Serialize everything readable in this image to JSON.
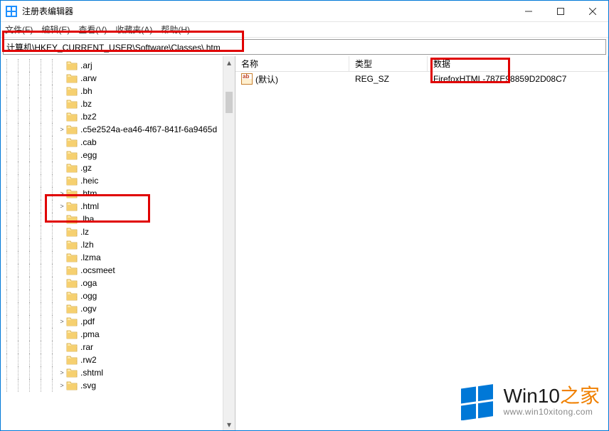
{
  "titlebar": {
    "title": "注册表编辑器"
  },
  "menubar": {
    "file": "文件(F)",
    "edit": "编辑(E)",
    "view": "查看(V)",
    "favorites": "收藏夹(A)",
    "help": "帮助(H)"
  },
  "addressbar": {
    "path": "计算机\\HKEY_CURRENT_USER\\Software\\Classes\\.htm"
  },
  "tree": {
    "items": [
      {
        "label": ".arj",
        "depth": 5,
        "caret": ""
      },
      {
        "label": ".arw",
        "depth": 5,
        "caret": ""
      },
      {
        "label": ".bh",
        "depth": 5,
        "caret": ""
      },
      {
        "label": ".bz",
        "depth": 5,
        "caret": ""
      },
      {
        "label": ".bz2",
        "depth": 5,
        "caret": ""
      },
      {
        "label": ".c5e2524a-ea46-4f67-841f-6a9465d",
        "depth": 5,
        "caret": ">"
      },
      {
        "label": ".cab",
        "depth": 5,
        "caret": ""
      },
      {
        "label": ".egg",
        "depth": 5,
        "caret": ""
      },
      {
        "label": ".gz",
        "depth": 5,
        "caret": ""
      },
      {
        "label": ".heic",
        "depth": 5,
        "caret": ""
      },
      {
        "label": ".htm",
        "depth": 5,
        "caret": ">"
      },
      {
        "label": ".html",
        "depth": 5,
        "caret": ">"
      },
      {
        "label": ".lha",
        "depth": 5,
        "caret": ""
      },
      {
        "label": ".lz",
        "depth": 5,
        "caret": ""
      },
      {
        "label": ".lzh",
        "depth": 5,
        "caret": ""
      },
      {
        "label": ".lzma",
        "depth": 5,
        "caret": ""
      },
      {
        "label": ".ocsmeet",
        "depth": 5,
        "caret": ""
      },
      {
        "label": ".oga",
        "depth": 5,
        "caret": ""
      },
      {
        "label": ".ogg",
        "depth": 5,
        "caret": ""
      },
      {
        "label": ".ogv",
        "depth": 5,
        "caret": ""
      },
      {
        "label": ".pdf",
        "depth": 5,
        "caret": ">"
      },
      {
        "label": ".pma",
        "depth": 5,
        "caret": ""
      },
      {
        "label": ".rar",
        "depth": 5,
        "caret": ""
      },
      {
        "label": ".rw2",
        "depth": 5,
        "caret": ""
      },
      {
        "label": ".shtml",
        "depth": 5,
        "caret": ">"
      },
      {
        "label": ".svg",
        "depth": 5,
        "caret": ">"
      }
    ]
  },
  "list": {
    "headers": {
      "name": "名称",
      "type": "类型",
      "data": "数据"
    },
    "rows": [
      {
        "name": "(默认)",
        "type": "REG_SZ",
        "data": "FirefoxHTML-787E98859D2D08C7"
      }
    ]
  },
  "watermark": {
    "brand_prefix": "Win10",
    "brand_suffix": "之家",
    "url": "www.win10xitong.com"
  },
  "colors": {
    "accent": "#0078d7",
    "annotation": "#e00000",
    "folder_light": "#ffe9a6",
    "folder_dark": "#f0c040",
    "watermark_orange": "#f08000"
  }
}
